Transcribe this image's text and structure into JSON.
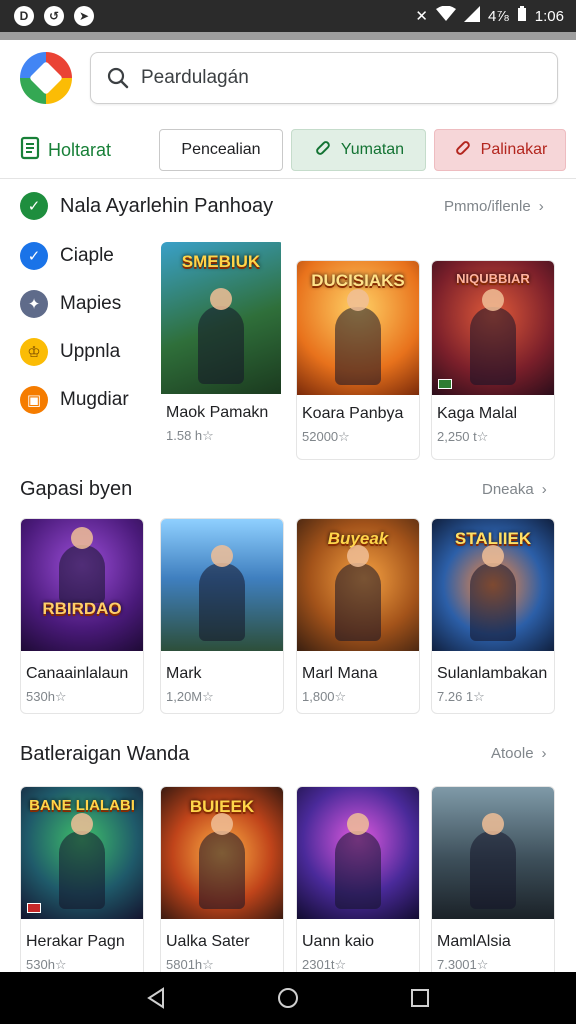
{
  "status_bar": {
    "time": "1:06",
    "signal_text": "4⅞"
  },
  "search": {
    "placeholder": "Peardulagán"
  },
  "tabs": {
    "home": "Holtarat",
    "items": [
      {
        "label": "Pencealian"
      },
      {
        "label": "Yumatan"
      },
      {
        "label": "Palinakar"
      }
    ]
  },
  "featured": {
    "title": "Nala Ayarlehin Panhoay",
    "more": "Pmmo/iflenle"
  },
  "categories": [
    {
      "label": "Ciaple",
      "color": "#1a73e8",
      "icon": "check-icon"
    },
    {
      "label": "Mapies",
      "color": "#5f6b8a",
      "icon": "compass-icon"
    },
    {
      "label": "Uppnla",
      "color": "#fbbc05",
      "icon": "crown-icon"
    },
    {
      "label": "Mugdiar",
      "color": "#f57c00",
      "icon": "wallet-icon"
    }
  ],
  "featured_cards": [
    {
      "art_text": "SMEBIUK",
      "title": "Maok Pamakn",
      "meta": "1.58 h☆"
    },
    {
      "art_text": "DUCISIAKS",
      "title": "Koara Panbya",
      "meta": "52000☆"
    },
    {
      "art_text": "NIQUBBIAR",
      "title": "Kaga Malal",
      "meta": "2,250 t☆"
    }
  ],
  "section2": {
    "title": "Gapasi byen",
    "more": "Dneaka",
    "cards": [
      {
        "art_text": "RBIRDAO",
        "title": "Canaainlalaun",
        "meta": "530h☆"
      },
      {
        "art_text": "",
        "title": "Mark",
        "meta": "1,20M☆"
      },
      {
        "art_text": "Buyeak",
        "title": "Marl Mana",
        "meta": "1,800☆"
      },
      {
        "art_text": "STALIIEK",
        "title": "Sulanlambakan",
        "meta": "7.26 1☆"
      }
    ]
  },
  "section3": {
    "title": "Batleraigan Wanda",
    "more": "Atoole",
    "cards": [
      {
        "art_text": "BANE LIALABI",
        "title": "Herakar Pagn",
        "meta": "530h☆"
      },
      {
        "art_text": "BUIEEK",
        "title": "Ualka Sater",
        "meta": "5801h☆"
      },
      {
        "art_text": "",
        "title": "Uann kaio",
        "meta": "2301t☆"
      },
      {
        "art_text": "",
        "title": "MamlAlsia",
        "meta": "7.3001☆"
      }
    ]
  },
  "nav_bar": {
    "icons": [
      "back-icon",
      "home-icon",
      "recents-icon"
    ]
  }
}
